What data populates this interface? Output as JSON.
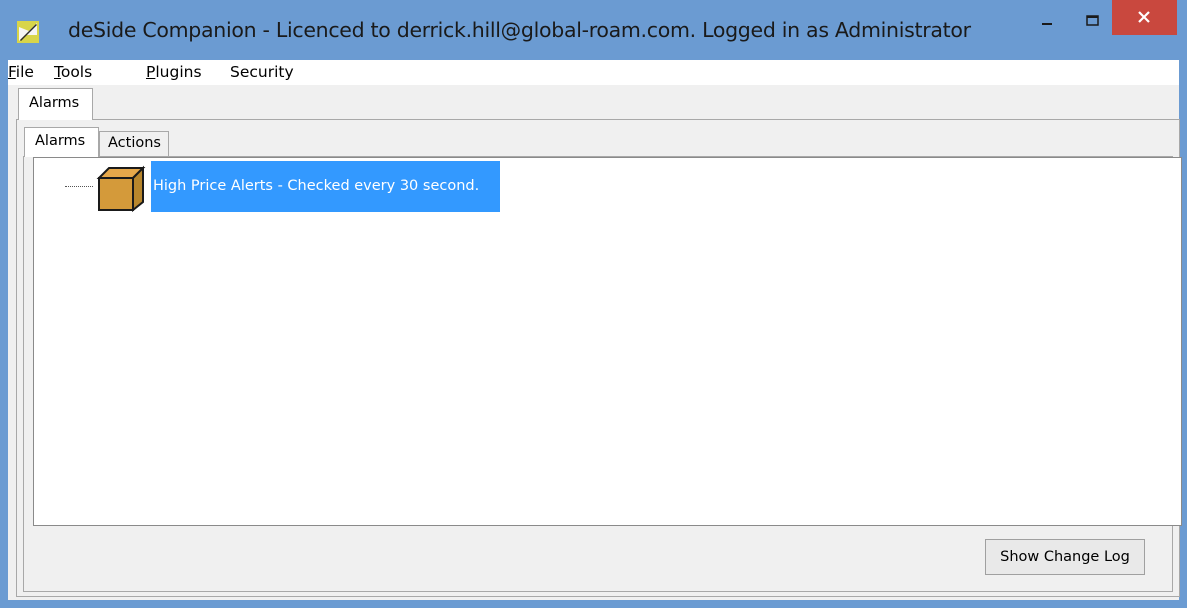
{
  "window": {
    "title": "deSide Companion - Licenced to derrick.hill@global-roam.com. Logged in as Administrator",
    "close_glyph": "✕",
    "accent_color": "#6b9bd2",
    "close_color": "#c9483e"
  },
  "menu": {
    "items": [
      {
        "label": "File",
        "mnemonic": "F",
        "rest": "ile"
      },
      {
        "label": "Tools",
        "mnemonic": "T",
        "rest": "ools"
      },
      {
        "label": "Plugins",
        "mnemonic": "P",
        "rest": "lugins"
      },
      {
        "label": "Security"
      }
    ]
  },
  "outer_tabs": [
    {
      "label": "Alarms",
      "selected": true
    }
  ],
  "inner_tabs": [
    {
      "label": "Alarms",
      "selected": true
    },
    {
      "label": "Actions",
      "selected": false
    }
  ],
  "tree": {
    "items": [
      {
        "label": "High Price Alerts - Checked every 30 second.",
        "icon": "box-icon",
        "selected": true
      }
    ],
    "selection_color": "#3399ff"
  },
  "footer": {
    "show_change_log_label": "Show Change Log"
  }
}
